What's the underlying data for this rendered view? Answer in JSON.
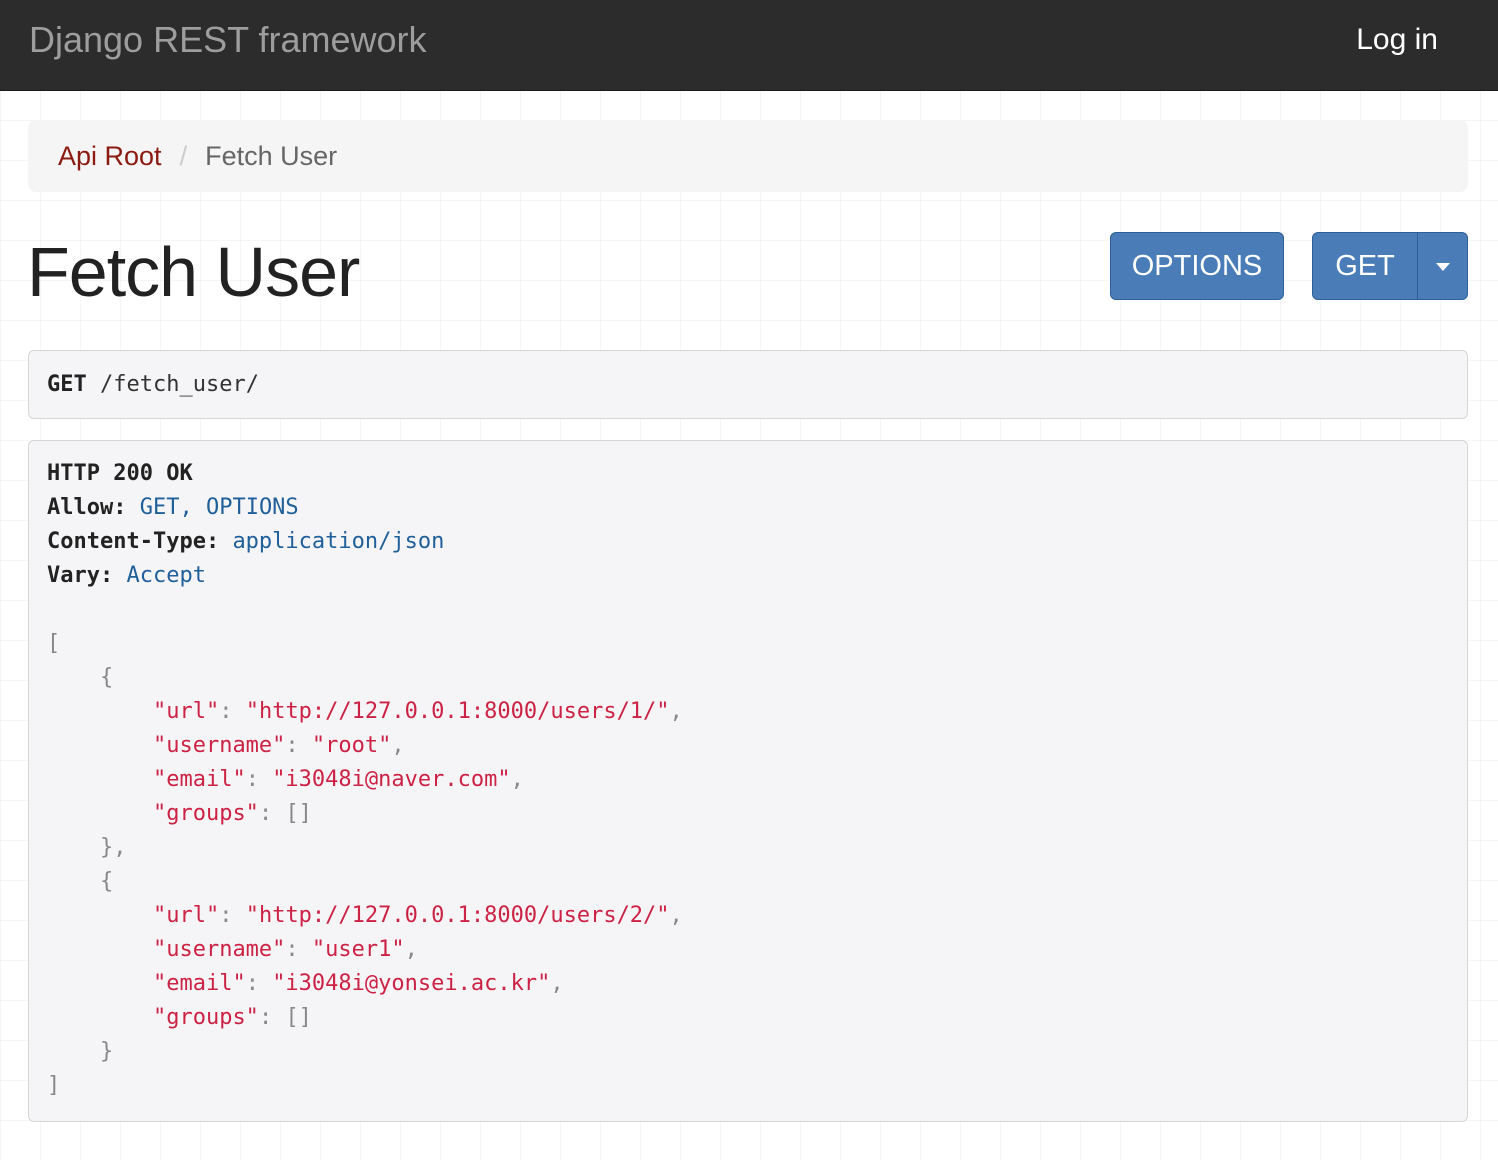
{
  "navbar": {
    "brand": "Django REST framework",
    "login_label": "Log in"
  },
  "breadcrumb": {
    "root_label": "Api Root",
    "separator": "/",
    "current_label": "Fetch User"
  },
  "page": {
    "title": "Fetch User"
  },
  "buttons": {
    "options_label": "OPTIONS",
    "get_label": "GET"
  },
  "request": {
    "method": "GET",
    "path": "/fetch_user/"
  },
  "response": {
    "status_line": "HTTP 200 OK",
    "headers": [
      {
        "name": "Allow:",
        "value": "GET, OPTIONS"
      },
      {
        "name": "Content-Type:",
        "value": "application/json"
      },
      {
        "name": "Vary:",
        "value": "Accept"
      }
    ],
    "users": [
      {
        "url": "\"http://127.0.0.1:8000/users/1/\"",
        "username": "\"root\"",
        "email": "\"i3048i@naver.com\"",
        "groups": "[]",
        "close": "},"
      },
      {
        "url": "\"http://127.0.0.1:8000/users/2/\"",
        "username": "\"user1\"",
        "email": "\"i3048i@yonsei.ac.kr\"",
        "groups": "[]",
        "close": "}"
      }
    ],
    "keys": {
      "url": "\"url\"",
      "username": "\"username\"",
      "email": "\"email\"",
      "groups": "\"groups\""
    },
    "open_bracket": "[",
    "close_bracket": "]",
    "open_brace": "{"
  },
  "colors": {
    "navbar_bg": "#2c2c2c",
    "button_primary": "#4a7db7",
    "crumb_link": "#8b1a10",
    "json_string": "#cc2244",
    "header_value": "#1f5f9a"
  }
}
